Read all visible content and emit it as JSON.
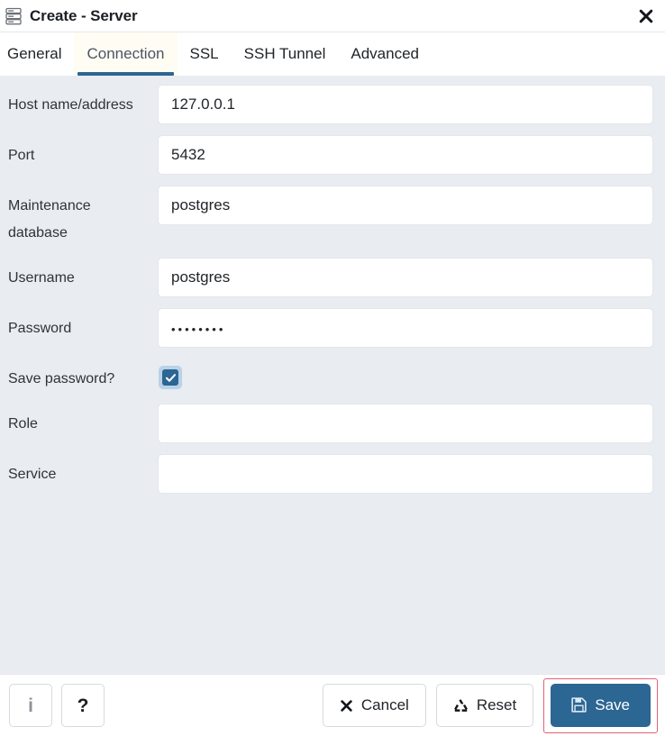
{
  "header": {
    "icon": "server-icon",
    "title": "Create - Server",
    "close_label": "✕"
  },
  "tabs": [
    {
      "label": "General",
      "active": false
    },
    {
      "label": "Connection",
      "active": true
    },
    {
      "label": "SSL",
      "active": false
    },
    {
      "label": "SSH Tunnel",
      "active": false
    },
    {
      "label": "Advanced",
      "active": false
    }
  ],
  "form": {
    "fields": [
      {
        "label": "Host name/address",
        "value": "127.0.0.1",
        "placeholder": "",
        "type": "text"
      },
      {
        "label": "Port",
        "value": "5432",
        "placeholder": "",
        "type": "text"
      },
      {
        "label": "Maintenance database",
        "value": "postgres",
        "placeholder": "",
        "type": "text"
      },
      {
        "label": "Username",
        "value": "postgres",
        "placeholder": "",
        "type": "text"
      },
      {
        "label": "Password",
        "value": "••••••••",
        "placeholder": "",
        "type": "password"
      },
      {
        "label": "Save password?",
        "value": "checked",
        "placeholder": "",
        "type": "checkbox"
      },
      {
        "label": "Role",
        "value": "",
        "placeholder": "",
        "type": "text"
      },
      {
        "label": "Service",
        "value": "",
        "placeholder": "",
        "type": "text"
      }
    ]
  },
  "footer": {
    "info_label": "i",
    "help_label": "?",
    "cancel_label": "Cancel",
    "reset_label": "Reset",
    "save_label": "Save"
  },
  "colors": {
    "accent_blue": "#2c6693",
    "form_background": "#e9ecf1",
    "tab_active_underline": "#2c6693",
    "tab_active_background": "#fffdf3",
    "highlight_red": "#e06377",
    "checkbox_ring": "#b9d2e8"
  }
}
